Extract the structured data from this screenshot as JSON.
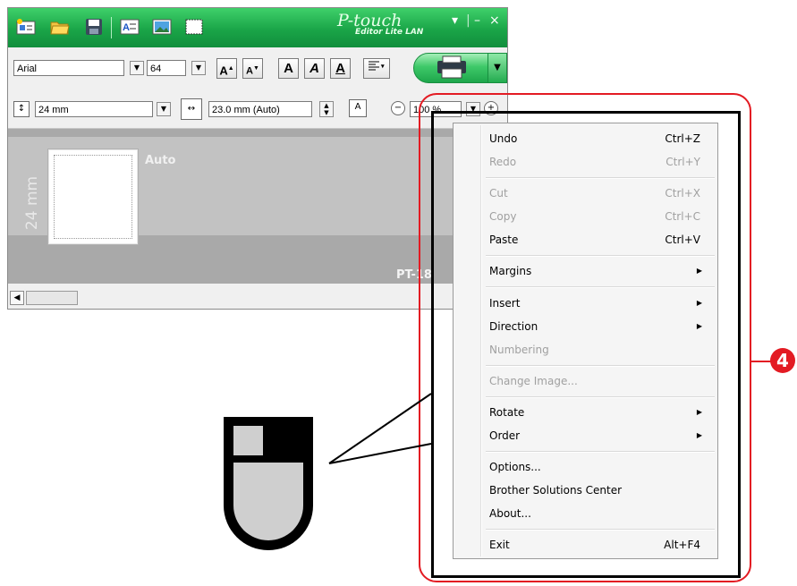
{
  "app": {
    "brand_main": "P-touch",
    "brand_sub": "Editor Lite LAN",
    "font_name": "Arial",
    "font_size": "64",
    "tape_width": "24 mm",
    "label_length": "23.0 mm (Auto)",
    "zoom": "100 %",
    "tape_side_text": "24 mm",
    "auto_text": "Auto",
    "model_text": "PT-18",
    "colors": {
      "title_green": "#1aa548",
      "callout_red": "#e31b23"
    }
  },
  "format_buttons": [
    "A",
    "A",
    "A",
    "A",
    "A"
  ],
  "menu": {
    "items": [
      {
        "label": "Undo",
        "shortcut": "Ctrl+Z"
      },
      {
        "label": "Redo",
        "shortcut": "Ctrl+Y"
      },
      {
        "label": "Cut",
        "shortcut": "Ctrl+X"
      },
      {
        "label": "Copy",
        "shortcut": "Ctrl+C"
      },
      {
        "label": "Paste",
        "shortcut": "Ctrl+V"
      },
      {
        "label": "Margins"
      },
      {
        "label": "Insert"
      },
      {
        "label": "Direction"
      },
      {
        "label": "Numbering"
      },
      {
        "label": "Change Image..."
      },
      {
        "label": "Rotate"
      },
      {
        "label": "Order"
      },
      {
        "label": "Options..."
      },
      {
        "label": "Brother Solutions Center"
      },
      {
        "label": "About..."
      },
      {
        "label": "Exit",
        "shortcut": "Alt+F4"
      }
    ]
  },
  "callout": {
    "number": "4"
  }
}
